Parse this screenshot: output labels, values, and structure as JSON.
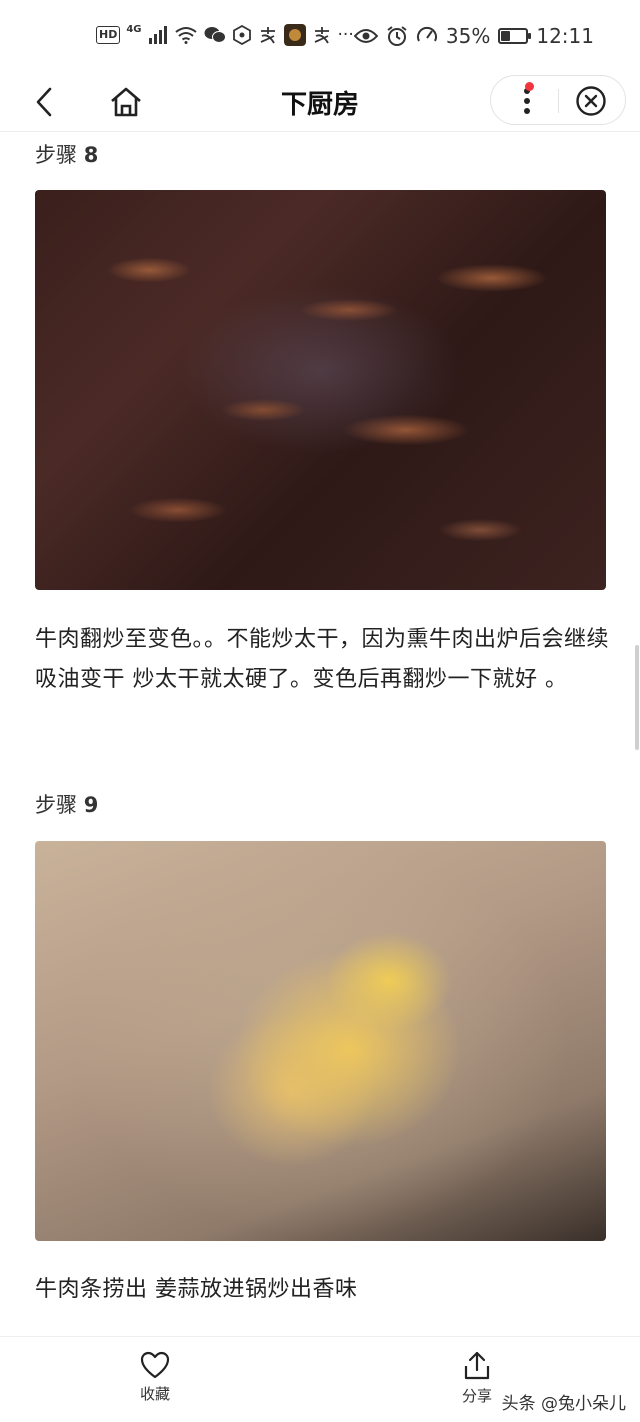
{
  "status_bar": {
    "hd": "HD",
    "network": "4G",
    "extra_icons": "···",
    "battery_percent": "35%",
    "battery_level": 0.35,
    "time": "12:11"
  },
  "nav": {
    "title": "下厨房",
    "notification_dot_color": "#f0353d"
  },
  "steps": [
    {
      "label": "步骤",
      "number": "8",
      "text": "牛肉翻炒至变色。。不能炒太干，因为熏牛肉出炉后会继续吸油变干 炒太干就太硬了。变色后再翻炒一下就好 。"
    },
    {
      "label": "步骤",
      "number": "9",
      "text": "牛肉条捞出 姜蒜放进锅炒出香味"
    }
  ],
  "bottom_bar": {
    "favorite_label": "收藏",
    "share_label": "分享",
    "watermark": "头条 @兔小朵儿"
  }
}
